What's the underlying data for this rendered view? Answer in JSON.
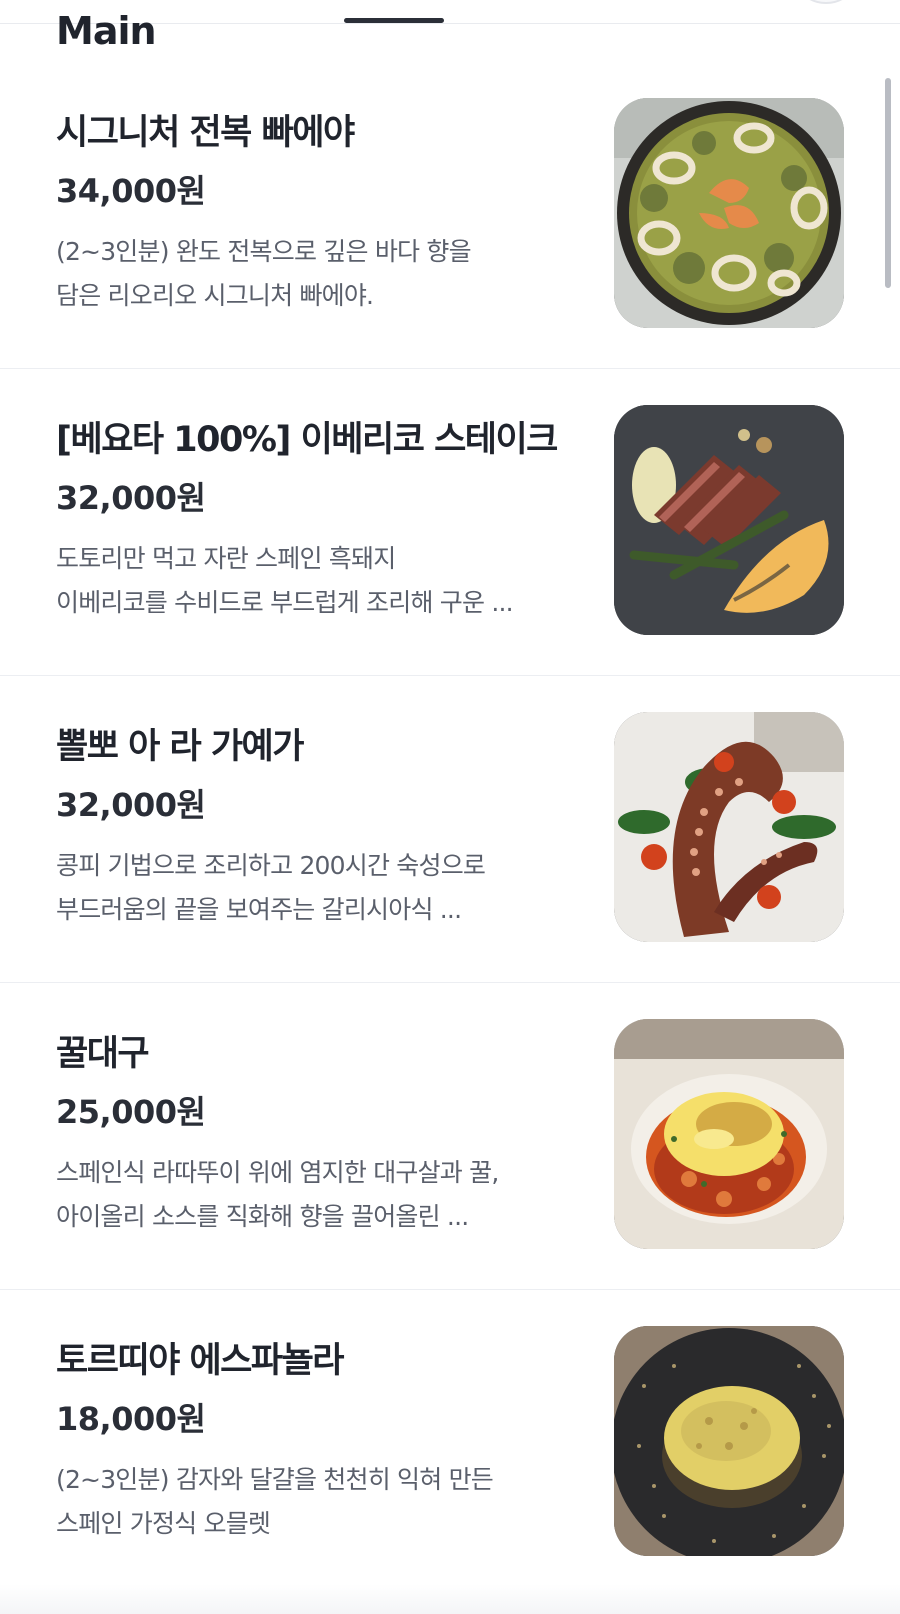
{
  "section": {
    "title": "Main"
  },
  "menu": [
    {
      "name": "시그니처 전복 빠에야",
      "price": "34,000원",
      "desc_line1": "(2~3인분) 완도 전복으로 깊은 바다 향을",
      "desc_line2": "담은 리오리오 시그니처 빠에야.",
      "photo": "paella-photo"
    },
    {
      "name": "[베요타 100%] 이베리코 스테이크",
      "price": "32,000원",
      "desc_line1": "도토리만 먹고 자란 스페인 흑돼지",
      "desc_line2": "이베리코를 수비드로 부드럽게 조리해 구운 ...",
      "photo": "iberico-steak-photo"
    },
    {
      "name": "뽈뽀 아 라 가예가",
      "price": "32,000원",
      "desc_line1": "콩피 기법으로 조리하고 200시간 숙성으로",
      "desc_line2": "부드러움의 끝을 보여주는 갈리시아식 ...",
      "photo": "octopus-photo"
    },
    {
      "name": "꿀대구",
      "price": "25,000원",
      "desc_line1": "스페인식 라따뚜이 위에 염지한 대구살과 꿀,",
      "desc_line2": "아이올리 소스를 직화해 향을 끌어올린 ...",
      "photo": "cod-photo"
    },
    {
      "name": "토르띠야 에스파뇰라",
      "price": "18,000원",
      "desc_line1": "(2~3인분) 감자와 달걀을 천천히 익혀 만든",
      "desc_line2": "스페인 가정식 오믈렛",
      "photo": "tortilla-photo"
    }
  ],
  "colors": {
    "text": "#20242d",
    "desc": "#5a5f6b",
    "divider": "#eceef2"
  }
}
